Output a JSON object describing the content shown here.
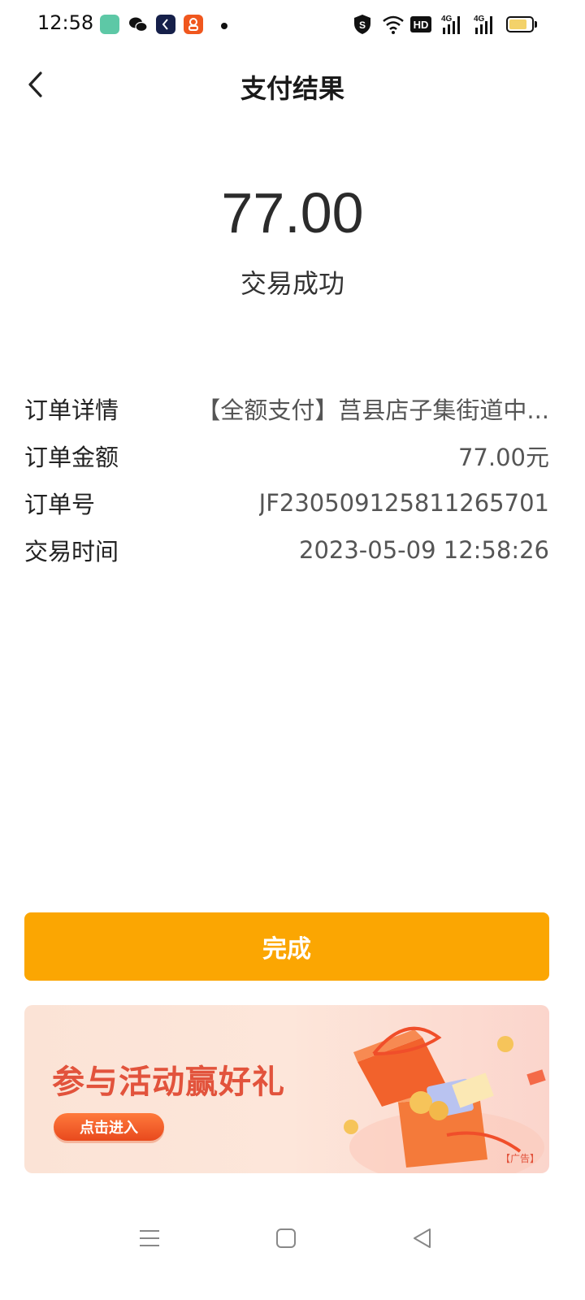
{
  "status_bar": {
    "time": "12:58",
    "icons": [
      "app-green-icon",
      "wechat-icon",
      "app-dark-icon",
      "app-orange-icon",
      "notification-dot-icon",
      "vpn-shield-icon",
      "wifi-icon",
      "hd-icon",
      "signal-4g-icon",
      "signal-4g-icon",
      "battery-icon"
    ],
    "hd_label": "HD",
    "signal_label": "4G",
    "battery_level": 0.8
  },
  "header": {
    "title": "支付结果",
    "back_icon": "chevron-left-icon"
  },
  "result": {
    "amount": "77.00",
    "status": "交易成功"
  },
  "details": [
    {
      "label": "订单详情",
      "value": "【全额支付】莒县店子集街道中..."
    },
    {
      "label": "订单金额",
      "value": "77.00元"
    },
    {
      "label": "订单号",
      "value": "JF230509125811265701"
    },
    {
      "label": "交易时间",
      "value": "2023-05-09 12:58:26"
    }
  ],
  "done_button": {
    "label": "完成"
  },
  "ad": {
    "title": "参与活动赢好礼",
    "cta": "点击进入",
    "tag": "【广告】"
  },
  "colors": {
    "accent": "#fba602",
    "ad_title": "#e2533c",
    "ad_background": "#fde6da"
  },
  "nav": {
    "icons": [
      "menu-icon",
      "home-icon",
      "back-triangle-icon"
    ]
  }
}
